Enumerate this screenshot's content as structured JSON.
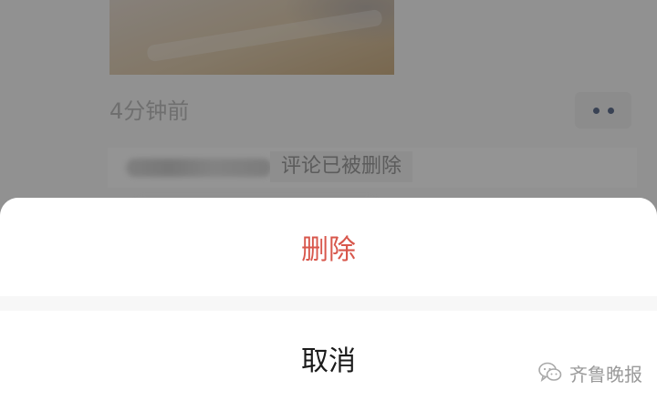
{
  "post": {
    "timestamp": "4分钟前",
    "comment_status": "评论已被删除"
  },
  "action_sheet": {
    "delete_label": "删除",
    "cancel_label": "取消"
  },
  "watermark": {
    "text": "齐鲁晚报",
    "icon": "wechat-icon"
  },
  "colors": {
    "destructive": "#d8574c",
    "link_dots": "#5f6f8d"
  }
}
